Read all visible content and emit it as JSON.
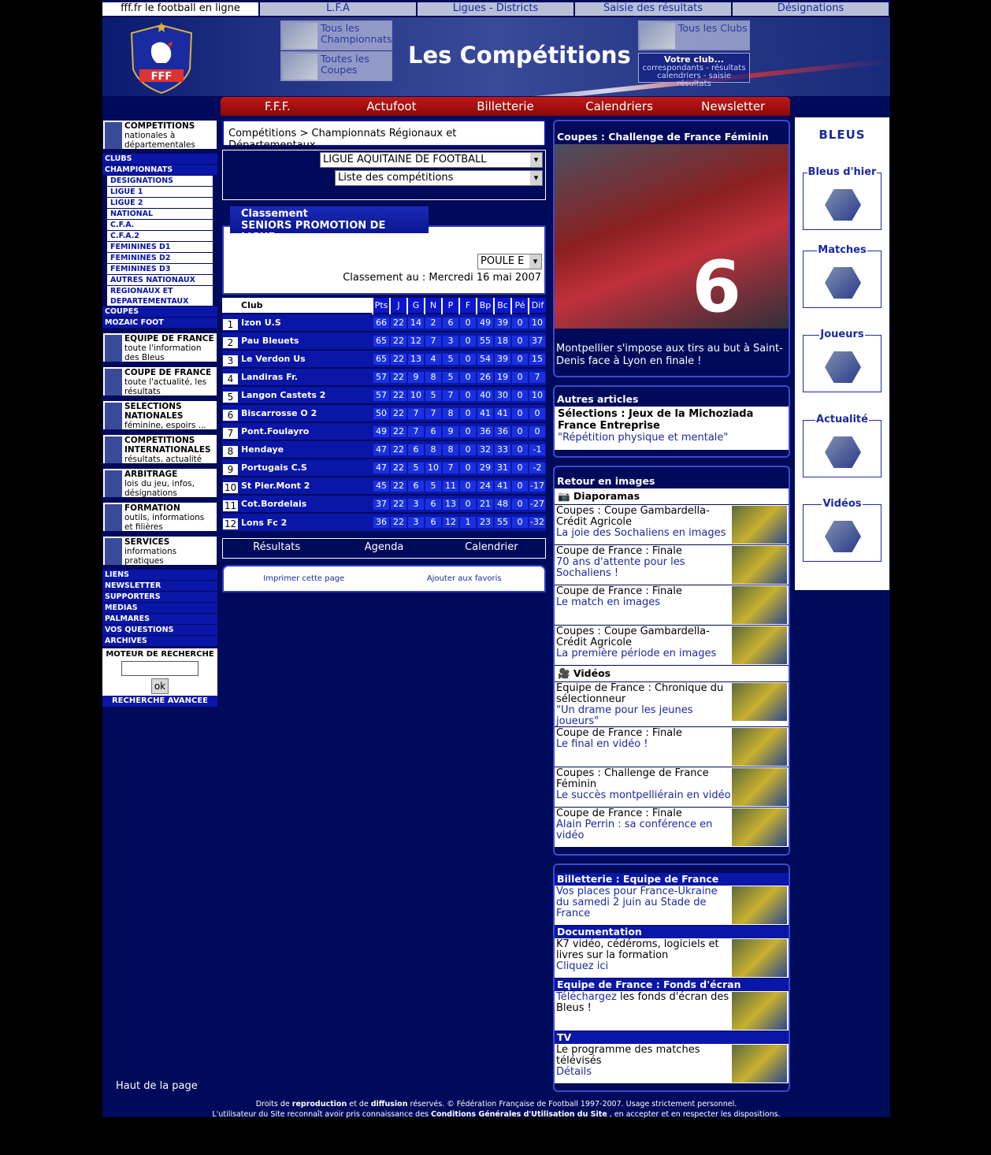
{
  "topnav": [
    "fff.fr le football en ligne",
    "L.F.A",
    "Ligues - Districts",
    "Saisie des résultats",
    "Désignations"
  ],
  "banner": {
    "title": "Les Compétitions",
    "logo_text": "FFF",
    "box1": "Tous les Championnats",
    "box2": "Toutes les Coupes",
    "box3": "Tous les Clubs",
    "votre_title": "Votre club...",
    "votre_l1": "correspondants - résultats",
    "votre_l2": "calendriers - saisie résultats"
  },
  "rednav": [
    "F.F.F.",
    "Actufoot",
    "Billetterie",
    "Calendriers",
    "Newsletter"
  ],
  "left": {
    "top_box": {
      "title": "COMPETITIONS",
      "text": "nationales à départementales"
    },
    "links_a": [
      "CLUBS",
      "CHAMPIONNATS"
    ],
    "sub": [
      "DESIGNATIONS",
      "LIGUE 1",
      "LIGUE 2",
      "NATIONAL",
      "C.F.A.",
      "C.F.A.2",
      "FEMININES D1",
      "FEMININES D2",
      "FEMININES D3",
      "AUTRES NATIONAUX",
      "REGIONAUX ET DEPARTEMENTAUX"
    ],
    "links_b": [
      "COUPES",
      "MOZAIC FOOT"
    ],
    "boxes": [
      {
        "title": "EQUIPE DE FRANCE",
        "text": "toute l'information des Bleus"
      },
      {
        "title": "COUPE DE FRANCE",
        "text": "toute l'actualité, les résultats"
      },
      {
        "title": "SELECTIONS NATIONALES",
        "text": "féminine, espoirs ..."
      },
      {
        "title": "COMPETITIONS INTERNATIONALES",
        "text": "résultats, actualité"
      },
      {
        "title": "ARBITRAGE",
        "text": "lois du jeu, infos, désignations"
      },
      {
        "title": "FORMATION",
        "text": "outils, informations et filières"
      },
      {
        "title": "SERVICES",
        "text": "informations pratiques"
      }
    ],
    "links_c": [
      "LIENS",
      "NEWSLETTER",
      "SUPPORTERS",
      "MEDIAS",
      "PALMARES",
      "VOS QUESTIONS",
      "ARCHIVES"
    ],
    "search_title": "MOTEUR DE RECHERCHE",
    "search_value": "",
    "search_button": "ok",
    "search_adv": "RECHERCHE AVANCEE"
  },
  "center": {
    "breadcrumb": "Compétitions > Championnats Régionaux et Départementaux",
    "select_league": "LIGUE AQUITAINE DE FOOTBALL",
    "select_comp": "Liste des compétitions",
    "class_title1": "Classement",
    "class_title2": "SENIORS PROMOTION DE LIGUE",
    "poule": "POULE E",
    "date": "Classement au : Mercredi 16 mai 2007",
    "headers": [
      "Club",
      "Pts",
      "J",
      "G",
      "N",
      "P",
      "F",
      "Bp",
      "Bc",
      "Pé",
      "Dif"
    ],
    "rows": [
      [
        "1",
        "Izon U.S",
        "66",
        "22",
        "14",
        "2",
        "6",
        "0",
        "49",
        "39",
        "0",
        "10"
      ],
      [
        "2",
        "Pau Bleuets",
        "65",
        "22",
        "12",
        "7",
        "3",
        "0",
        "55",
        "18",
        "0",
        "37"
      ],
      [
        "3",
        "Le Verdon Us",
        "65",
        "22",
        "13",
        "4",
        "5",
        "0",
        "54",
        "39",
        "0",
        "15"
      ],
      [
        "4",
        "Landiras Fr.",
        "57",
        "22",
        "9",
        "8",
        "5",
        "0",
        "26",
        "19",
        "0",
        "7"
      ],
      [
        "5",
        "Langon Castets 2",
        "57",
        "22",
        "10",
        "5",
        "7",
        "0",
        "40",
        "30",
        "0",
        "10"
      ],
      [
        "6",
        "Biscarrosse O 2",
        "50",
        "22",
        "7",
        "7",
        "8",
        "0",
        "41",
        "41",
        "0",
        "0"
      ],
      [
        "7",
        "Pont.Foulayro",
        "49",
        "22",
        "7",
        "6",
        "9",
        "0",
        "36",
        "36",
        "0",
        "0"
      ],
      [
        "8",
        "Hendaye",
        "47",
        "22",
        "6",
        "8",
        "8",
        "0",
        "32",
        "33",
        "0",
        "-1"
      ],
      [
        "9",
        "Portugais C.S",
        "47",
        "22",
        "5",
        "10",
        "7",
        "0",
        "29",
        "31",
        "0",
        "-2"
      ],
      [
        "10",
        "St Pier.Mont 2",
        "45",
        "22",
        "6",
        "5",
        "11",
        "0",
        "24",
        "41",
        "0",
        "-17"
      ],
      [
        "11",
        "Cot.Bordelais",
        "37",
        "22",
        "3",
        "6",
        "13",
        "0",
        "21",
        "48",
        "0",
        "-27"
      ],
      [
        "12",
        "Lons Fc 2",
        "36",
        "22",
        "3",
        "6",
        "12",
        "1",
        "23",
        "55",
        "0",
        "-32"
      ]
    ],
    "tabs": [
      "Résultats",
      "Agenda",
      "Calendrier"
    ],
    "print": "Imprimer cette page",
    "fav": "Ajouter aux favoris"
  },
  "right": {
    "coupe_title": "Coupes : Challenge de France Féminin",
    "coupe_caption": "Montpellier s'impose aux tirs au but à Saint-Denis face à Lyon en finale !",
    "autres_title": "Autres articles",
    "autres_bold": "Sélections : Jeux de la Michoziada France Entreprise",
    "autres_link": "\"Répétition physique et mentale\"",
    "retour_title": "Retour en images",
    "diapo_title": "Diaporamas",
    "diapos": [
      {
        "t": "Coupes : Coupe Gambardella-Crédit Agricole",
        "l": "La joie des Sochaliens en images"
      },
      {
        "t": "Coupe de France : Finale",
        "l": "70 ans d'attente pour les Sochaliens !"
      },
      {
        "t": "Coupe de France : Finale",
        "l": "Le match en images"
      },
      {
        "t": "Coupes : Coupe Gambardella-Crédit Agricole",
        "l": "La première période en images"
      }
    ],
    "videos_title": "Vidéos",
    "videos": [
      {
        "t": "Equipe de France : Chronique du sélectionneur",
        "l": "\"Un drame pour les jeunes joueurs\""
      },
      {
        "t": "Coupe de France : Finale",
        "l": "Le final en vidéo !"
      },
      {
        "t": "Coupes : Challenge de France Féminin",
        "l": "Le succès montpelliérain en vidéo"
      },
      {
        "t": "Coupe de France : Finale",
        "l": "Alain Perrin : sa conférence en vidéo"
      }
    ],
    "billet_title": "Billetterie : Equipe de France",
    "billet_link": "Vos places pour France-Ukraine du samedi 2 juin au Stade de France",
    "doc_title": "Documentation",
    "doc_text": "K7 vidéo, cédéroms, logiciels et livres sur la formation",
    "doc_link": "Cliquez ici",
    "fonds_title": "Equipe de France : Fonds d'écran",
    "fonds_link": "Téléchargez",
    "fonds_text": "les fonds d'écran des Bleus !",
    "tv_title": "TV",
    "tv_text": "Le programme des matches télévisés",
    "tv_link": "Détails"
  },
  "far": {
    "title": "BLEUS",
    "items": [
      "Bleus d'hier",
      "Matches",
      "Joueurs",
      "Actualité",
      "Vidéos"
    ]
  },
  "footer": {
    "top": "Haut de la page",
    "l1_a": "Droits de",
    "l1_b": "reproduction",
    "l1_c": "et de",
    "l1_d": "diffusion",
    "l1_e": "réservés. © Fédération Française de Football 1997-2007. Usage strictement personnel.",
    "l2_a": "L'utilisateur du Site reconnaît avoir pris connaissance des",
    "l2_b": "Conditions Générales d'Utilisation du Site",
    "l2_c": ", en accepter et en respecter les dispositions."
  }
}
